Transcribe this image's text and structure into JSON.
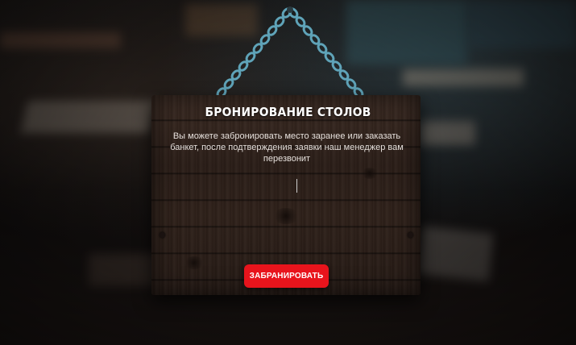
{
  "booking": {
    "title": "БРОНИРОВАНИЕ СТОЛОВ",
    "description": "Вы можете забронировать место заранее или заказать банкет, после подтверждения заявки наш менеджер вам перезвонит",
    "button_label": "ЗАБРАНИРОВАТЬ"
  },
  "colors": {
    "button": "#e8141c",
    "chain": "#5fa3b8",
    "board": "#2b1e18"
  }
}
